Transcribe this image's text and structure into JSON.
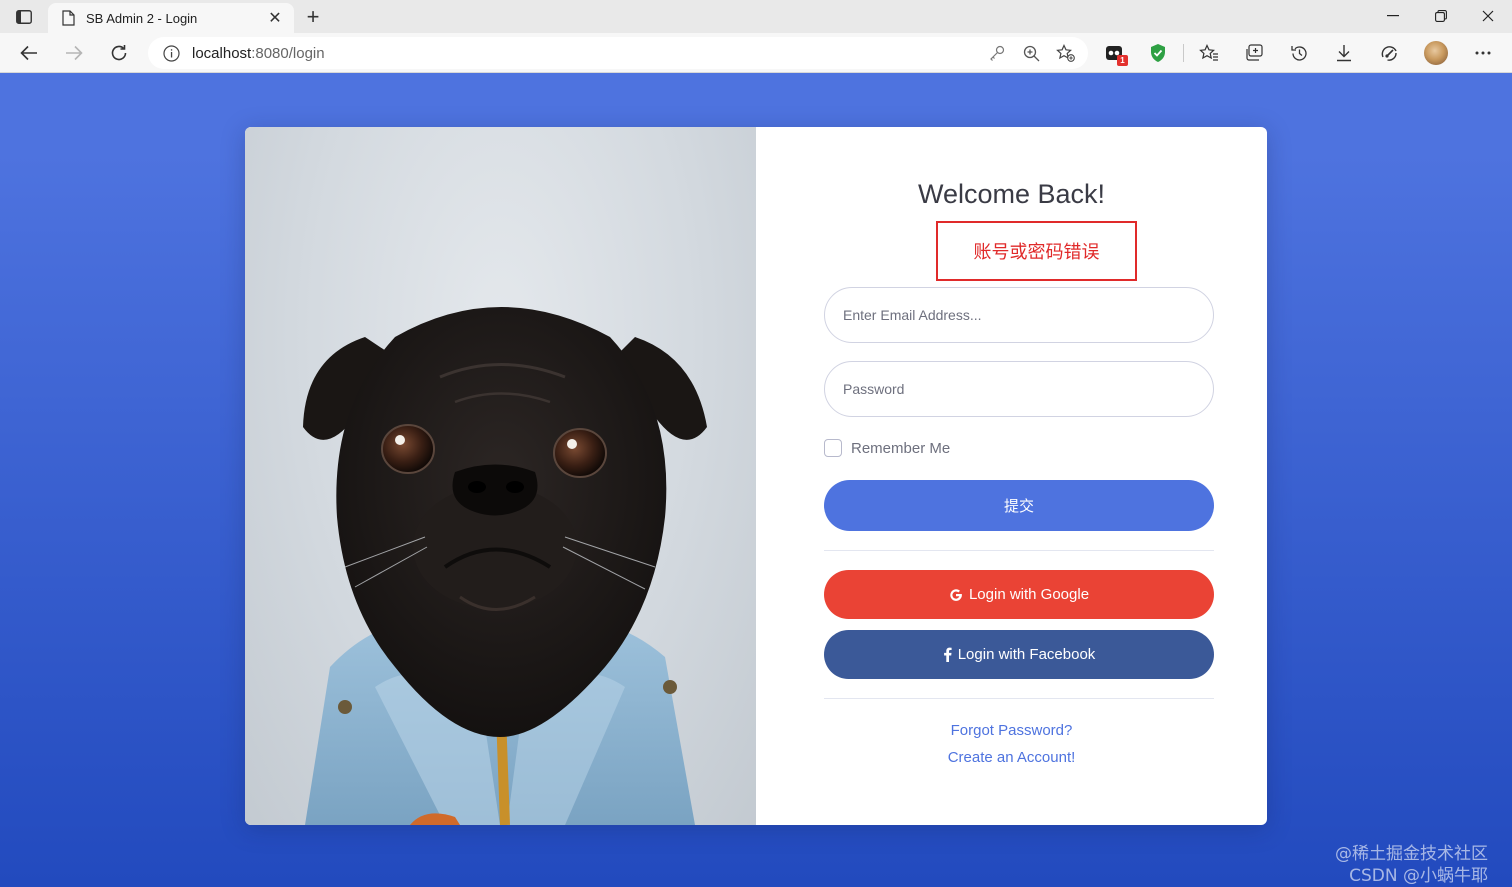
{
  "browser": {
    "tab_title": "SB Admin 2 - Login",
    "url_host": "localhost",
    "url_rest": ":8080/login",
    "extension_badge": "1",
    "icons": [
      "tab-panel-icon",
      "page-icon",
      "close-icon",
      "plus-icon",
      "minimize-icon",
      "restore-icon",
      "window-close-icon",
      "back-arrow-icon",
      "forward-arrow-icon",
      "refresh-icon",
      "info-icon",
      "key-icon",
      "zoom-icon",
      "favorite-add-icon",
      "extension-icon",
      "shield-icon",
      "favorites-icon",
      "collections-icon",
      "history-icon",
      "download-icon",
      "performance-icon",
      "profile-avatar",
      "more-icon"
    ]
  },
  "login": {
    "title": "Welcome Back!",
    "error": "账号或密码错误",
    "email_placeholder": "Enter Email Address...",
    "password_placeholder": "Password",
    "remember_label": "Remember Me",
    "submit_label": "提交",
    "google_label": "Login with Google",
    "facebook_label": "Login with Facebook",
    "forgot_link": "Forgot Password?",
    "create_link": "Create an Account!"
  },
  "watermark": {
    "line1": "@稀土掘金技术社区",
    "line2": "CSDN @小蜗牛耶"
  },
  "colors": {
    "primary": "#4e73df",
    "google": "#ea4335",
    "facebook": "#3b5998",
    "error": "#e02a2a"
  }
}
